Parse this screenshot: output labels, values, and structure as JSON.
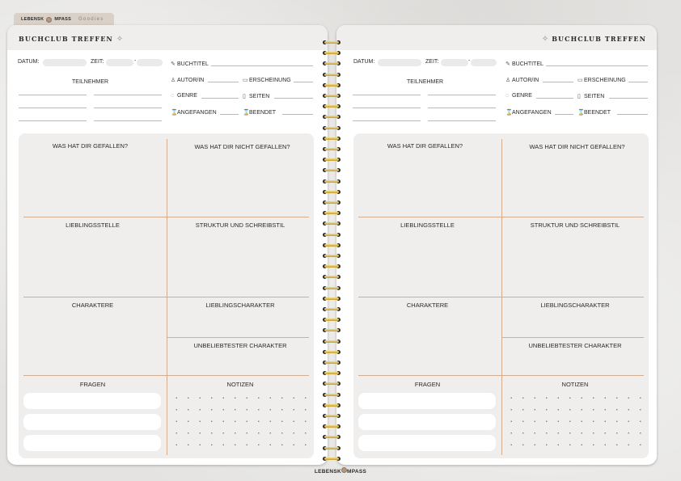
{
  "brand": {
    "name_a": "LEBENSK",
    "name_b": "MPASS",
    "tab_suffix": "Goodies"
  },
  "title": "BUCHCLUB TREFFEN",
  "fields": {
    "datum": "DATUM:",
    "zeit": "ZEIT:",
    "dash": "-",
    "teilnehmer": "TEILNEHMER",
    "buchtitel": "BUCHTITEL",
    "autor": "AUTOR/IN",
    "erscheinung": "ERSCHEINUNG",
    "genre": "GENRE",
    "seiten": "SEITEN",
    "angefangen": "ANGEFANGEN",
    "beendet": "BEENDET"
  },
  "sections": {
    "gefallen": "WAS HAT DIR GEFALLEN?",
    "nicht_gefallen": "WAS HAT DIR NICHT GEFALLEN?",
    "lieblingsstelle": "LIEBLINGSSTELLE",
    "struktur": "STRUKTUR UND SCHREIBSTIL",
    "charaktere": "CHARAKTERE",
    "lieblingscharakter": "LIEBLINGSCHARAKTER",
    "unbeliebtester": "UNBELIEBTESTER CHARAKTER",
    "fragen": "FRAGEN",
    "notizen": "NOTIZEN"
  },
  "icons": {
    "buchtitel": "pencil-icon",
    "autor": "person-icon",
    "erscheinung": "calendar-icon",
    "genre": "speech-bubble-icon",
    "seiten": "page-icon",
    "angefangen": "hourglass-icon",
    "beendet": "hourglass-icon",
    "sparkle": "sparkle-icon"
  },
  "colors": {
    "accent_line": "#d2ad8f",
    "panel": "#efeeec",
    "wire": "#d4a93a"
  }
}
